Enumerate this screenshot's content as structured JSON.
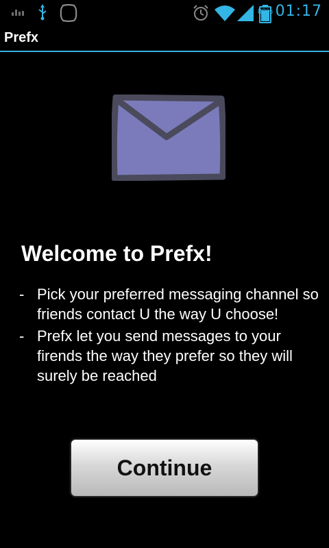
{
  "status_bar": {
    "time": "01:17",
    "battery_percent": "89%",
    "icons": [
      "signal-bars-small-icon",
      "usb-icon",
      "notification-bubble-icon",
      "alarm-icon",
      "wifi-icon",
      "cell-signal-icon",
      "battery-icon"
    ],
    "accent_color": "#33b5e5"
  },
  "action_bar": {
    "title": "Prefx"
  },
  "hero": {
    "icon": "envelope-icon",
    "icon_color": "#7b7bbb"
  },
  "welcome": {
    "heading": "Welcome to Prefx!",
    "bullets": [
      {
        "dash": "-",
        "text": "Pick your preferred messaging channel so friends contact U the way U choose!"
      },
      {
        "dash": "-",
        "text": "Prefx let you send messages to your firends the way they prefer so they will surely be reached"
      }
    ]
  },
  "actions": {
    "continue_label": "Continue"
  }
}
